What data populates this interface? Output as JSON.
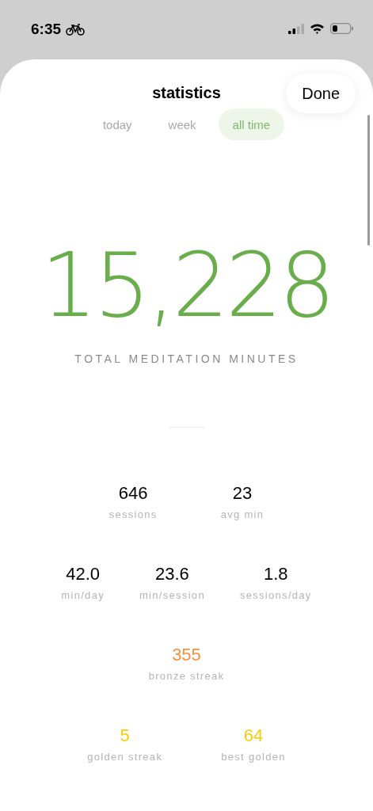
{
  "status_bar": {
    "time": "6:35"
  },
  "sheet": {
    "title": "statistics",
    "done_button": "Done"
  },
  "tabs": [
    {
      "label": "today",
      "selected": false
    },
    {
      "label": "week",
      "selected": false
    },
    {
      "label": "all time",
      "selected": true
    }
  ],
  "total": {
    "value": "15,228",
    "label": "TOTAL MEDITATION MINUTES"
  },
  "stat_rows": [
    [
      {
        "value": "646",
        "label": "sessions",
        "color": "#000000"
      },
      {
        "value": "23",
        "label": "avg min",
        "color": "#000000"
      }
    ],
    [
      {
        "value": "42.0",
        "label": "min/day",
        "color": "#000000"
      },
      {
        "value": "23.6",
        "label": "min/session",
        "color": "#000000"
      },
      {
        "value": "1.8",
        "label": "sessions/day",
        "color": "#000000"
      }
    ],
    [
      {
        "value": "355",
        "label": "bronze streak",
        "color": "#f6903a"
      }
    ],
    [
      {
        "value": "5",
        "label": "golden streak",
        "color": "#fccc0a"
      },
      {
        "value": "64",
        "label": "best golden",
        "color": "#fccc0a"
      }
    ]
  ]
}
